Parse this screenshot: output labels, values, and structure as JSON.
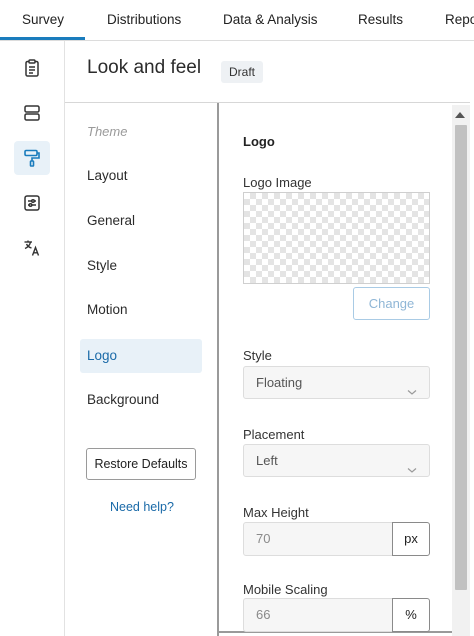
{
  "topnav": {
    "tabs": [
      {
        "label": "Survey",
        "active": true
      },
      {
        "label": "Distributions"
      },
      {
        "label": "Data & Analysis"
      },
      {
        "label": "Results"
      },
      {
        "label": "Repo"
      }
    ]
  },
  "rail": {
    "items": [
      {
        "icon": "survey-clipboard-icon"
      },
      {
        "icon": "blocks-icon"
      },
      {
        "icon": "paint-roller-icon",
        "active": true
      },
      {
        "icon": "survey-options-icon"
      },
      {
        "icon": "translate-icon"
      }
    ]
  },
  "header": {
    "title": "Look and feel",
    "badge": "Draft"
  },
  "menu": {
    "heading": "Theme",
    "items": [
      {
        "label": "Layout"
      },
      {
        "label": "General"
      },
      {
        "label": "Style"
      },
      {
        "label": "Motion"
      },
      {
        "label": "Logo",
        "active": true
      },
      {
        "label": "Background"
      }
    ],
    "restore_label": "Restore Defaults",
    "help_label": "Need help?"
  },
  "settings": {
    "section_title": "Logo",
    "logo_image_label": "Logo Image",
    "change_label": "Change",
    "style_label": "Style",
    "style_value": "Floating",
    "placement_label": "Placement",
    "placement_value": "Left",
    "max_height_label": "Max Height",
    "max_height_value": "70",
    "max_height_unit": "px",
    "mobile_scaling_label": "Mobile Scaling",
    "mobile_scaling_value": "66",
    "mobile_scaling_unit": "%"
  },
  "colors": {
    "accent": "#1a7cbd",
    "active_bg": "#e8f1f8",
    "link": "#1a6aa8"
  }
}
